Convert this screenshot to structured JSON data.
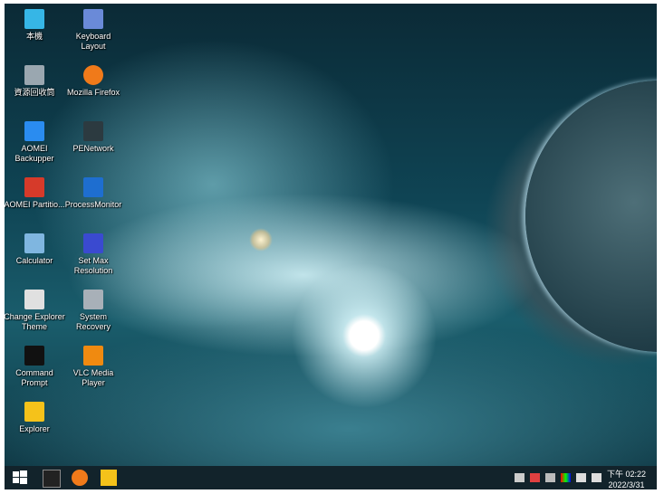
{
  "desktop_icons": [
    {
      "label": "本機",
      "icon": "computer-icon",
      "color": "#36b6e6"
    },
    {
      "label": "Keyboard Layout",
      "icon": "keyboard-icon",
      "color": "#6a8ad8"
    },
    {
      "label": "資源回收筒",
      "icon": "recycle-bin-icon",
      "color": "#9aa7b0"
    },
    {
      "label": "Mozilla Firefox",
      "icon": "firefox-icon",
      "color": "#f07a1a"
    },
    {
      "label": "AOMEI Backupper",
      "icon": "aomei-backupper-icon",
      "color": "#2a8cf0"
    },
    {
      "label": "PENetwork",
      "icon": "network-monitor-icon",
      "color": "#2c3a40"
    },
    {
      "label": "AOMEI Partitio...",
      "icon": "aomei-partition-icon",
      "color": "#d63a2a"
    },
    {
      "label": "ProcessMonitor",
      "icon": "process-monitor-icon",
      "color": "#1e6ed0"
    },
    {
      "label": "Calculator",
      "icon": "calculator-icon",
      "color": "#7fb6e0"
    },
    {
      "label": "Set Max Resolution",
      "icon": "display-settings-icon",
      "color": "#3a4ad0"
    },
    {
      "label": "Change Explorer Theme",
      "icon": "theme-icon",
      "color": "#e0e0e0"
    },
    {
      "label": "System Recovery",
      "icon": "system-recovery-icon",
      "color": "#a8b0b8"
    },
    {
      "label": "Command Prompt",
      "icon": "command-prompt-icon",
      "color": "#111111"
    },
    {
      "label": "VLC Media Player",
      "icon": "vlc-icon",
      "color": "#f08a10"
    },
    {
      "label": "Explorer",
      "icon": "folder-icon",
      "color": "#f5c21a"
    }
  ],
  "taskbar": {
    "pinned": [
      {
        "icon": "windows-start-icon",
        "color": "#ffffff"
      },
      {
        "icon": "command-prompt-icon",
        "color": "#222222"
      },
      {
        "icon": "firefox-icon",
        "color": "#f07a1a"
      },
      {
        "icon": "file-explorer-icon",
        "color": "#f5c21a"
      }
    ],
    "tray": [
      "network-icon",
      "usb-icon",
      "keyboard-icon",
      "color-display-icon",
      "battery-icon",
      "volume-icon"
    ],
    "time": "下午 02:22",
    "date": "2022/3/31"
  }
}
